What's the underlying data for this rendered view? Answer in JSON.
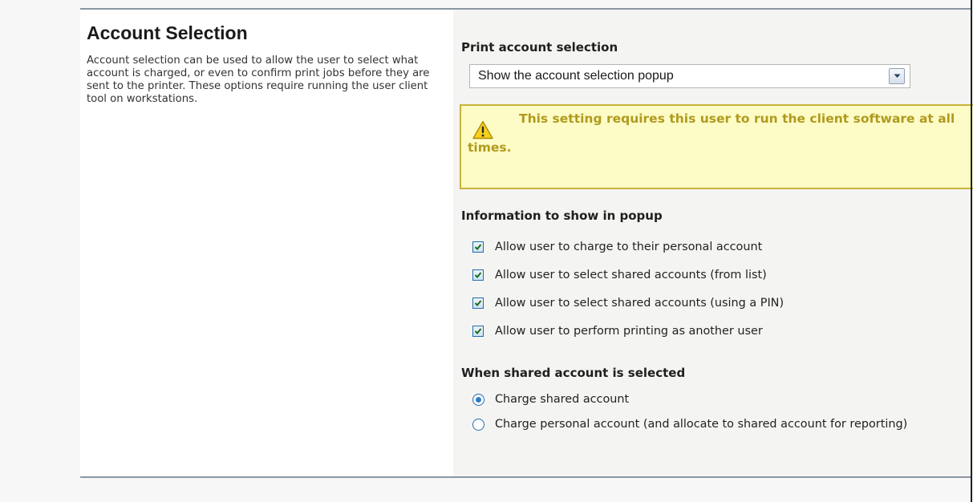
{
  "section": {
    "title": "Account Selection",
    "description": "Account selection can be used to allow the user to select what account is charged, or even to confirm print jobs before they are sent to the printer. These options require running the user client tool on workstations."
  },
  "print_account_selection": {
    "label": "Print account selection",
    "selected_value": "Show the account selection popup"
  },
  "warning": {
    "icon": "warning-icon",
    "text": "This setting requires this user to run the client software at all times."
  },
  "popup_info": {
    "label": "Information to show in popup",
    "options": [
      {
        "label": "Allow user to charge to their personal account",
        "checked": true
      },
      {
        "label": "Allow user to select shared accounts (from list)",
        "checked": true
      },
      {
        "label": "Allow user to select shared accounts (using a PIN)",
        "checked": true
      },
      {
        "label": "Allow user to perform printing as another user",
        "checked": true
      }
    ]
  },
  "shared_account": {
    "label": "When shared account is selected",
    "options": [
      {
        "label": "Charge shared account",
        "selected": true
      },
      {
        "label": "Charge personal account (and allocate to shared account for reporting)",
        "selected": false
      }
    ]
  },
  "colors": {
    "warning_text": "#b09a1e",
    "warning_bg": "#fdfcc6",
    "warning_border": "#c8b23a",
    "panel_border": "#8a96a2",
    "control_blue": "#1f6bb0"
  }
}
